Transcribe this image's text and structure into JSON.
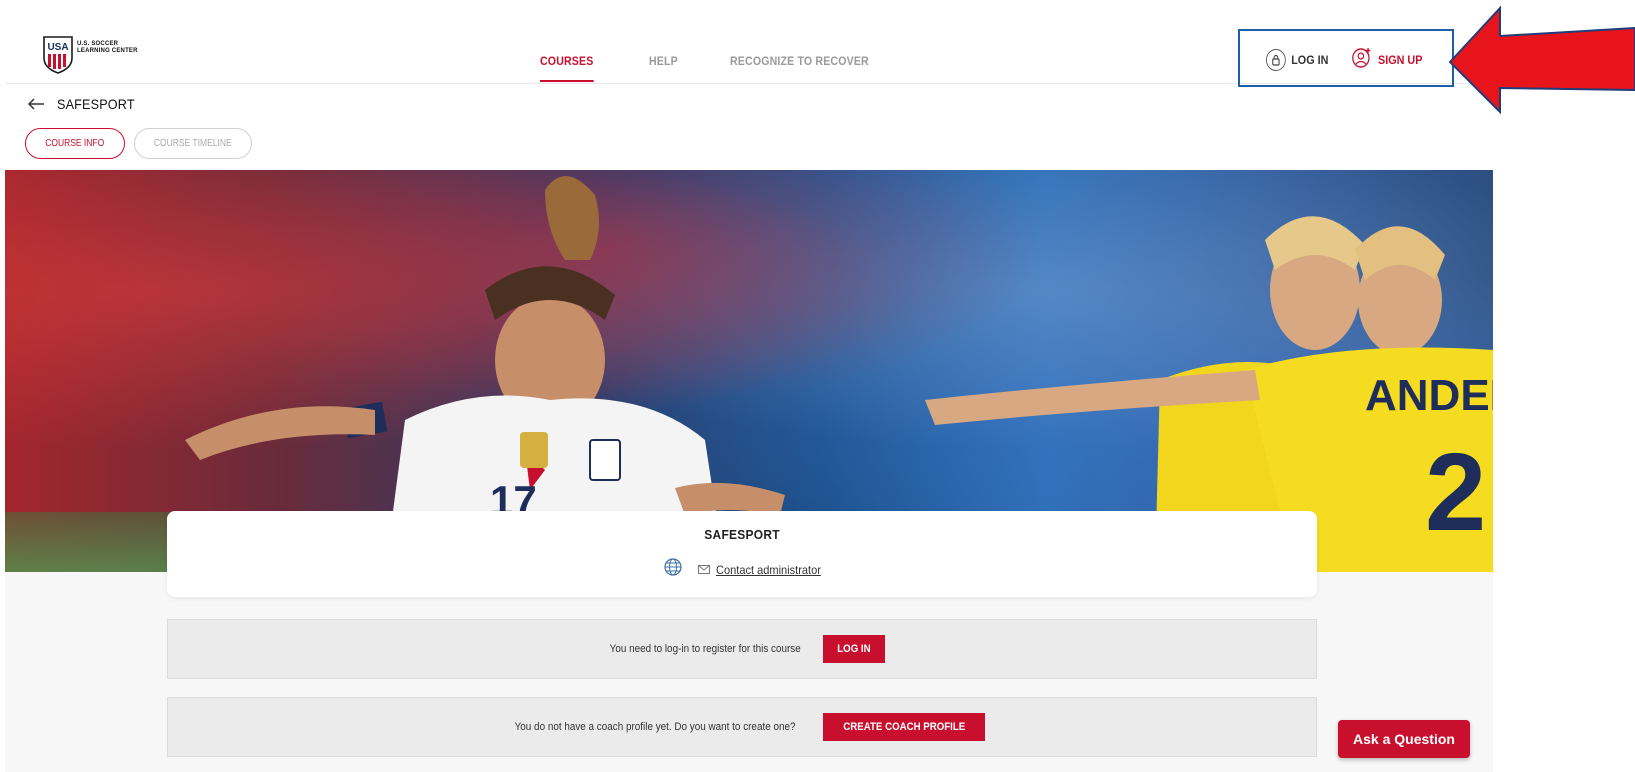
{
  "header": {
    "logo": {
      "mark": "USA",
      "line1": "U.S. SOCCER",
      "line2": "LEARNING CENTER"
    },
    "nav": [
      {
        "label": "COURSES",
        "active": true
      },
      {
        "label": "HELP",
        "active": false
      },
      {
        "label": "RECOGNIZE TO RECOVER",
        "active": false
      }
    ],
    "auth": {
      "login_label": "LOG IN",
      "login_icon": "lock-icon",
      "signup_label": "SIGN UP",
      "signup_icon": "user-add-icon"
    }
  },
  "breadcrumb": {
    "back_icon": "arrow-left-icon",
    "title": "SAFESPORT"
  },
  "tabs": [
    {
      "label": "COURSE INFO",
      "active": true
    },
    {
      "label": "COURSE TIMELINE",
      "active": false
    }
  ],
  "course": {
    "title": "SAFESPORT",
    "globe_icon": "globe-icon",
    "contact_icon": "mail-icon",
    "contact_label": "Contact administrator"
  },
  "notices": {
    "login": {
      "text": "You need to log-in to register for this course",
      "button": "LOG IN"
    },
    "coach": {
      "text": "You do not have a  coach  profile yet. Do you want to create one?",
      "button": "CREATE COACH PROFILE"
    }
  },
  "ask_button": "Ask a Question",
  "colors": {
    "accent": "#c8102e",
    "highlight_box": "#1f5fa8",
    "annotation_arrow": "#e8141c"
  }
}
